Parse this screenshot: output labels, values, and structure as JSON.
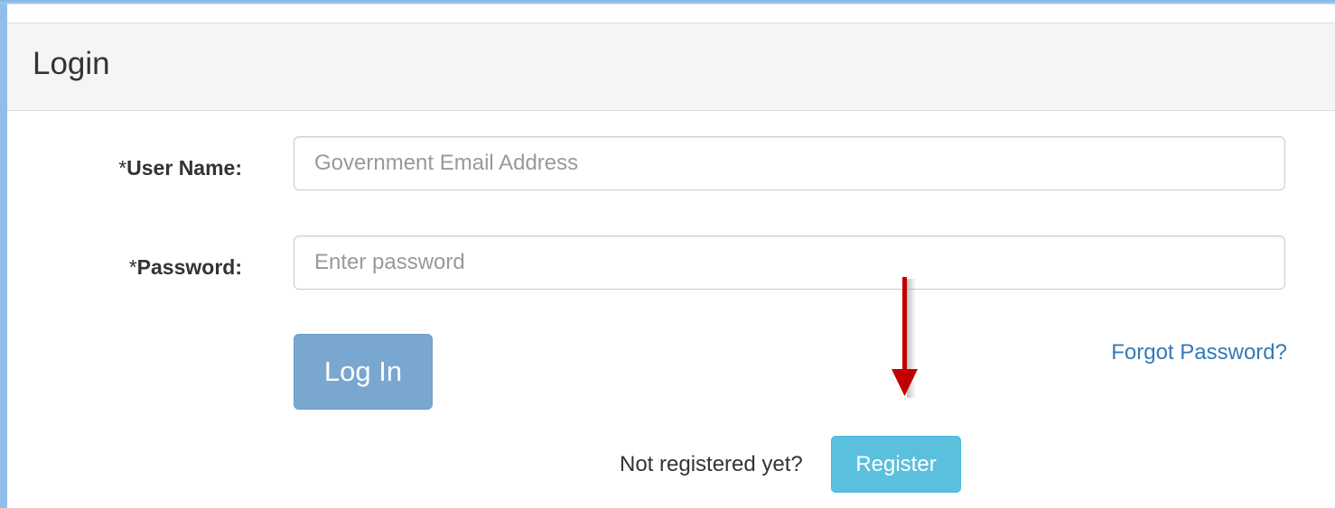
{
  "panel": {
    "title": "Login"
  },
  "form": {
    "username": {
      "required_mark": "*",
      "label": "User Name:",
      "placeholder": "Government Email Address",
      "value": ""
    },
    "password": {
      "required_mark": "*",
      "label": "Password:",
      "placeholder": "Enter password",
      "value": ""
    },
    "login_button": "Log In",
    "forgot_link": "Forgot Password?",
    "register_prompt": "Not registered yet?",
    "register_button": "Register"
  },
  "colors": {
    "login_button": "#7aa7d0",
    "register_button": "#5bc0de",
    "link": "#337ab7",
    "annotation_arrow": "#c00000"
  },
  "icons": {
    "annotation": "down-arrow-icon"
  }
}
